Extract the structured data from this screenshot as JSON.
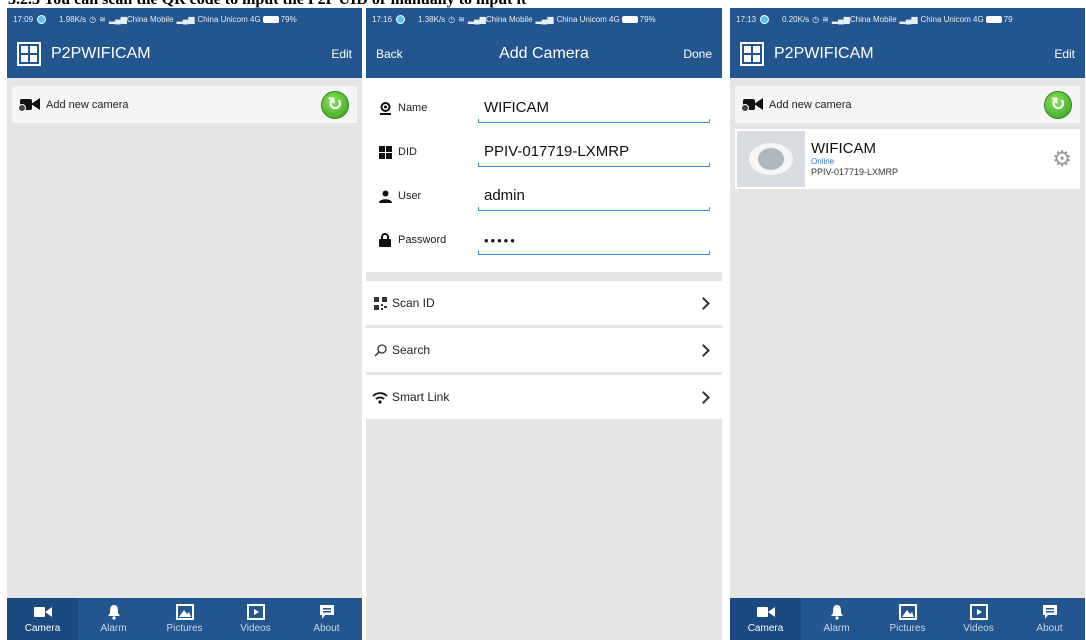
{
  "caption": "3.2.3 You can scan the QR code to input the P2P UID or manually to input it",
  "colors": {
    "navbar": "#23558f",
    "accent_line": "#3a8fd0",
    "online": "#2f7cc7",
    "background": "#e5e5e5"
  },
  "screens": [
    {
      "status": {
        "time": "17:09",
        "speed": "1.98K/s",
        "carrier1": "China Mobile",
        "carrier2": "China Unicom 4G",
        "battery": "79%"
      },
      "header": {
        "title": "P2PWIFICAM",
        "right": "Edit"
      },
      "add_bar": {
        "label": "Add new camera",
        "icon": "camera-add-icon",
        "action_icon": "refresh-icon"
      },
      "tabs": [
        {
          "label": "Camera",
          "icon": "video-camera-icon"
        },
        {
          "label": "Alarm",
          "icon": "bell-icon"
        },
        {
          "label": "Pictures",
          "icon": "picture-icon"
        },
        {
          "label": "Videos",
          "icon": "film-icon"
        },
        {
          "label": "About",
          "icon": "chat-icon"
        }
      ]
    },
    {
      "status": {
        "time": "17:16",
        "speed": "1.38K/s",
        "carrier1": "China Mobile",
        "carrier2": "China Unicom 4G",
        "battery": "79%"
      },
      "header": {
        "left": "Back",
        "title": "Add Camera",
        "right": "Done"
      },
      "form": {
        "name": {
          "label": "Name",
          "value": "WIFICAM",
          "icon": "user-badge-icon"
        },
        "did": {
          "label": "DID",
          "value": "PPIV-017719-LXMRP",
          "icon": "grid-icon"
        },
        "user": {
          "label": "User",
          "value": "admin",
          "icon": "person-icon"
        },
        "password": {
          "label": "Password",
          "value": "•••••",
          "icon": "lock-icon"
        }
      },
      "menu": [
        {
          "label": "Scan ID",
          "icon": "qr-code-icon"
        },
        {
          "label": "Search",
          "icon": "search-icon"
        },
        {
          "label": "Smart Link",
          "icon": "wifi-icon"
        }
      ]
    },
    {
      "status": {
        "time": "17:13",
        "speed": "0.20K/s",
        "carrier1": "China Mobile",
        "carrier2": "China Unicom 4G",
        "battery": "79"
      },
      "header": {
        "title": "P2PWIFICAM",
        "right": "Edit"
      },
      "add_bar": {
        "label": "Add new camera",
        "icon": "camera-add-icon",
        "action_icon": "refresh-icon"
      },
      "camera": {
        "name": "WIFICAM",
        "status": "Online",
        "did": "PPIV-017719-LXMRP",
        "settings_icon": "gear-icon"
      },
      "tabs": [
        {
          "label": "Camera",
          "icon": "video-camera-icon"
        },
        {
          "label": "Alarm",
          "icon": "bell-icon"
        },
        {
          "label": "Pictures",
          "icon": "picture-icon"
        },
        {
          "label": "Videos",
          "icon": "film-icon"
        },
        {
          "label": "About",
          "icon": "chat-icon"
        }
      ]
    }
  ]
}
